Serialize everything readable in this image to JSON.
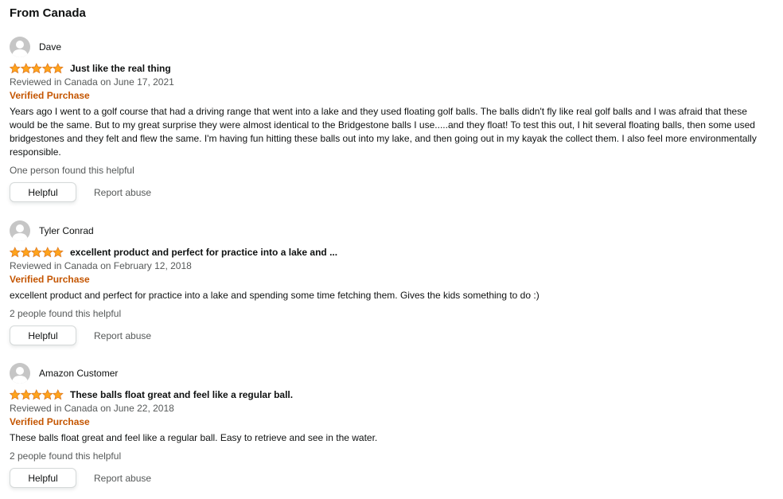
{
  "section": {
    "title": "From Canada"
  },
  "colors": {
    "star": "#ffa41c",
    "star_stroke": "#de7921",
    "verified": "#c45500",
    "muted": "#565959",
    "avatar": "#c6c6c6"
  },
  "reviews": [
    {
      "author": "Dave",
      "rating": 5,
      "title": "Just like the real thing",
      "date": "Reviewed in Canada on June 17, 2021",
      "verified": "Verified Purchase",
      "body": "Years ago I went to a golf course that had a driving range that went into a lake and they used floating golf balls. The balls didn't fly like real golf balls and I was afraid that these would be the same. But to my great surprise they were almost identical to the Bridgestone balls I use.....and they float! To test this out, I hit several floating balls, then some used bridgestones and they felt and flew the same. I'm having fun hitting these balls out into my lake, and then going out in my kayak the collect them. I also feel more environmentally responsible.",
      "helpful_count": "One person found this helpful",
      "helpful_label": "Helpful",
      "report_label": "Report abuse"
    },
    {
      "author": "Tyler Conrad",
      "rating": 5,
      "title": "excellent product and perfect for practice into a lake and ...",
      "date": "Reviewed in Canada on February 12, 2018",
      "verified": "Verified Purchase",
      "body": "excellent product and perfect for practice into a lake and spending some time fetching them. Gives the kids something to do :)",
      "helpful_count": "2 people found this helpful",
      "helpful_label": "Helpful",
      "report_label": "Report abuse"
    },
    {
      "author": "Amazon Customer",
      "rating": 5,
      "title": "These balls float great and feel like a regular ball.",
      "date": "Reviewed in Canada on June 22, 2018",
      "verified": "Verified Purchase",
      "body": "These balls float great and feel like a regular ball. Easy to retrieve and see in the water.",
      "helpful_count": "2 people found this helpful",
      "helpful_label": "Helpful",
      "report_label": "Report abuse"
    }
  ]
}
